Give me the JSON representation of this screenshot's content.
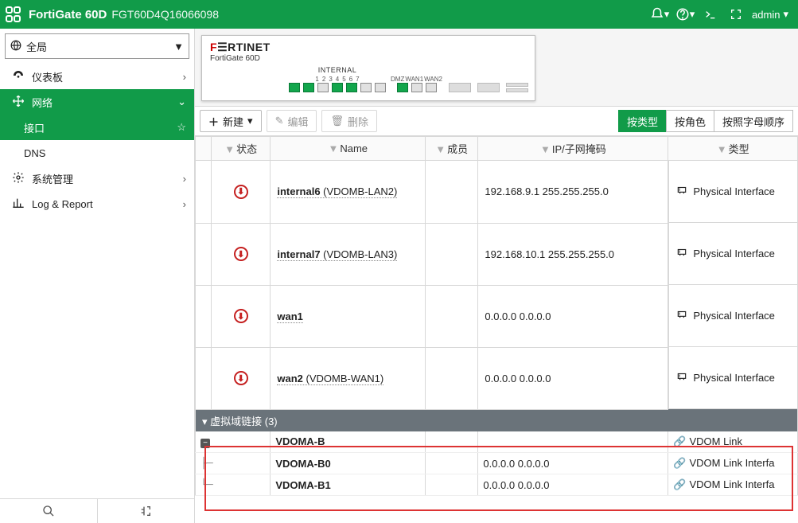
{
  "header": {
    "product": "FortiGate 60D",
    "serial": "FGT60D4Q16066098",
    "user": "admin"
  },
  "sidebar": {
    "scope": "全局",
    "items": [
      {
        "icon": "dash",
        "label": "仪表板",
        "sub": []
      },
      {
        "icon": "net",
        "label": "网络",
        "active": true,
        "sub": [
          {
            "label": "接口",
            "selected": true
          },
          {
            "label": "DNS"
          }
        ]
      },
      {
        "icon": "gear",
        "label": "系统管理"
      },
      {
        "icon": "log",
        "label": "Log & Report"
      }
    ]
  },
  "device": {
    "brand_a": "F",
    "brand_b": "RTINET",
    "model": "FortiGate 60D",
    "group_label": "INTERNAL",
    "ports_int": [
      1,
      1,
      0,
      1,
      1,
      0,
      0
    ],
    "ext_labels": [
      "DMZ",
      "WAN1",
      "WAN2"
    ],
    "ports_ext": [
      1,
      0,
      0
    ]
  },
  "toolbar": {
    "create": "新建",
    "edit": "编辑",
    "delete": "删除",
    "view": [
      "按类型",
      "按角色",
      "按照字母顺序"
    ],
    "view_active": 0
  },
  "columns": [
    "",
    "状态",
    "Name",
    "成员",
    "IP/子网掩码",
    "类型"
  ],
  "rows": [
    {
      "status": "down",
      "name_b": "internal6",
      "name_r": " (VDOMB-LAN2)",
      "ip": "192.168.9.1 255.255.255.0",
      "type": "Physical Interface"
    },
    {
      "status": "down",
      "name_b": "internal7",
      "name_r": " (VDOMB-LAN3)",
      "ip": "192.168.10.1 255.255.255.0",
      "type": "Physical Interface"
    },
    {
      "status": "down",
      "name_b": "wan1",
      "name_r": "",
      "ip": "0.0.0.0 0.0.0.0",
      "type": "Physical Interface"
    },
    {
      "status": "down",
      "name_b": "wan2",
      "name_r": " (VDOMB-WAN1)",
      "ip": "0.0.0.0 0.0.0.0",
      "type": "Physical Interface"
    }
  ],
  "section": {
    "label": "虚拟域链接",
    "count": "(3)"
  },
  "links": [
    {
      "tree": "root",
      "name": "VDOMA-B",
      "ip": "",
      "type": "VDOM Link"
    },
    {
      "tree": "leaf",
      "name": "VDOMA-B0",
      "ip": "0.0.0.0 0.0.0.0",
      "type": "VDOM Link Interfa"
    },
    {
      "tree": "leaf",
      "name": "VDOMA-B1",
      "ip": "0.0.0.0 0.0.0.0",
      "type": "VDOM Link Interfa"
    }
  ]
}
